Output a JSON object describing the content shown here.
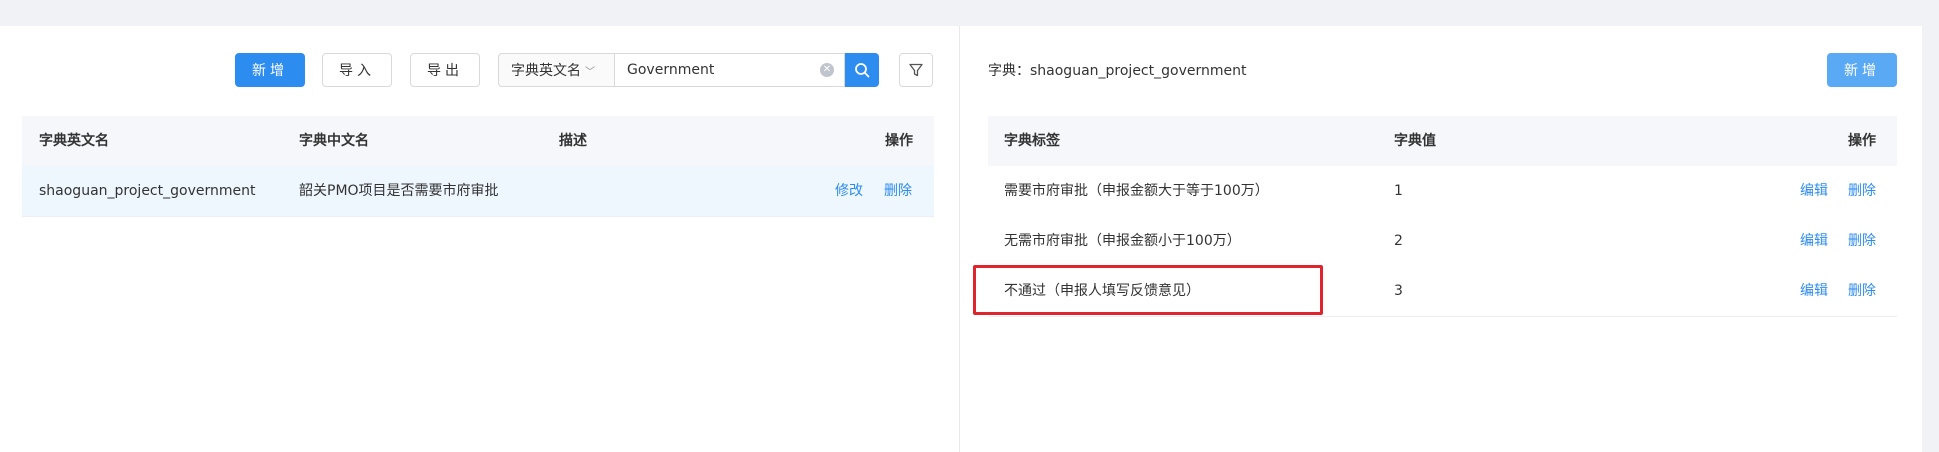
{
  "left": {
    "toolbar": {
      "add_label": "新增",
      "import_label": "导入",
      "export_label": "导出",
      "search_field_label": "字典英文名",
      "search_value": "Government"
    },
    "table": {
      "headers": [
        "字典英文名",
        "字典中文名",
        "描述",
        "操作"
      ],
      "rows": [
        {
          "en_name": "shaoguan_project_government",
          "cn_name": "韶关PMO项目是否需要市府审批",
          "desc": "",
          "edit": "修改",
          "delete": "删除"
        }
      ]
    }
  },
  "right": {
    "dict_label": "字典：shaoguan_project_government",
    "add_label": "新增",
    "table": {
      "headers": [
        "字典标签",
        "字典值",
        "操作"
      ],
      "rows": [
        {
          "label": "需要市府审批（申报金额大于等于100万）",
          "value": "1",
          "edit": "编辑",
          "delete": "删除"
        },
        {
          "label": "无需市府审批（申报金额小于100万）",
          "value": "2",
          "edit": "编辑",
          "delete": "删除"
        },
        {
          "label": "不通过（申报人填写反馈意见）",
          "value": "3",
          "edit": "编辑",
          "delete": "删除"
        }
      ]
    }
  },
  "colors": {
    "primary": "#2d8cf0",
    "highlight": "#e0242d"
  }
}
